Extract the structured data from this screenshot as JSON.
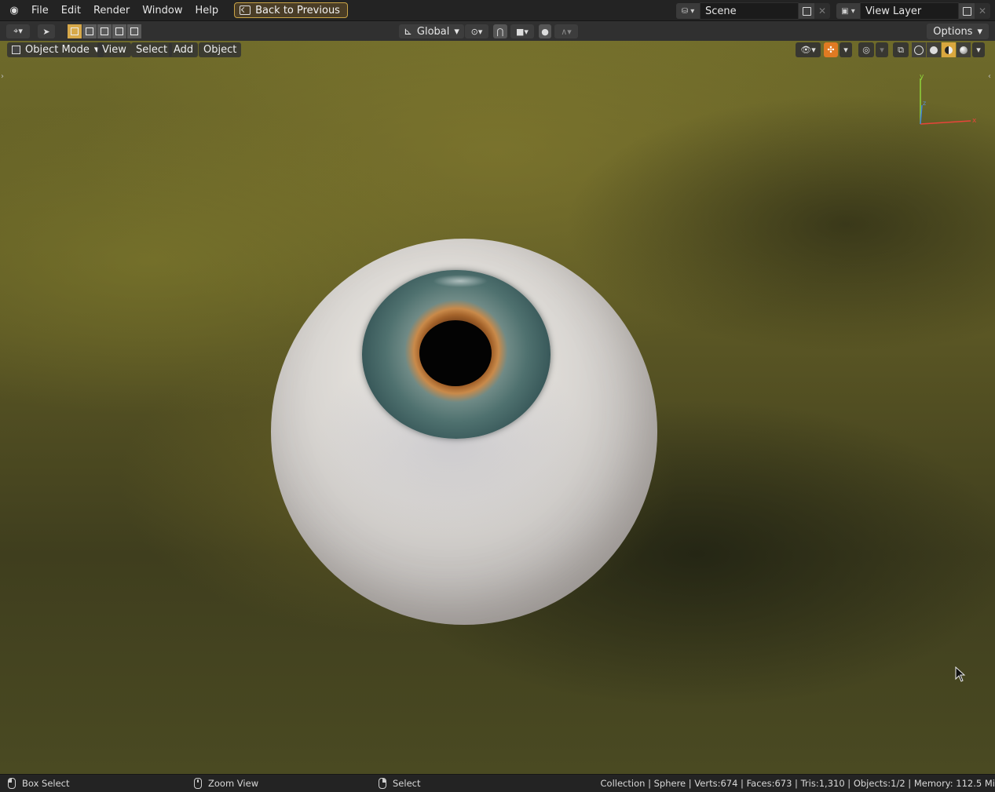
{
  "topbar": {
    "menus": [
      "File",
      "Edit",
      "Render",
      "Window",
      "Help"
    ],
    "back_button": "Back to Previous",
    "scene_name": "Scene",
    "view_layer_name": "View Layer"
  },
  "toolbar": {
    "transform_orientation": "Global",
    "options_label": "Options"
  },
  "viewport": {
    "mode": "Object Mode",
    "menus": [
      "View",
      "Select",
      "Add",
      "Object"
    ],
    "gizmo": {
      "x_label": "x",
      "y_label": "y",
      "z_label": "z"
    }
  },
  "statusbar": {
    "left_action": "Box Select",
    "middle_action": "Zoom View",
    "right_action": "Select",
    "stats": "Collection | Sphere | Verts:674 | Faces:673 | Tris:1,310 | Objects:1/2 | Memory: 112.5 Mi"
  },
  "colors": {
    "accent_orange": "#e07a22",
    "active_yellow": "#d7a94a",
    "gizmo_x": "#e8443a",
    "gizmo_y": "#8fd43a",
    "gizmo_z": "#3f7fd9"
  }
}
